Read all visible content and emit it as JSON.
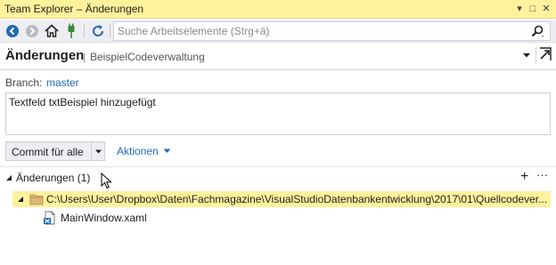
{
  "window": {
    "title": "Team Explorer – Änderungen",
    "controls": {
      "menu": "▾",
      "maximize": "□",
      "close": "✕"
    }
  },
  "toolbar": {
    "icons": [
      "back-icon",
      "forward-icon",
      "home-icon",
      "connect-icon",
      "refresh-icon"
    ],
    "search_placeholder": "Suche Arbeitselemente (Strg+ä)"
  },
  "header": {
    "title": "Änderungen",
    "separator": "|",
    "subtitle": "BeispielCodeverwaltung"
  },
  "branch": {
    "label": "Branch:",
    "value": "master"
  },
  "commit_message": "Textfeld txtBeispiel hinzugefügt",
  "commit_button": {
    "label": "Commit für alle"
  },
  "actions_label": "Aktionen",
  "changes_section": {
    "title": "Änderungen (1)",
    "add": "+",
    "more": "···",
    "folder_path": "C:\\Users\\User\\Dropbox\\Daten\\Fachmagazine\\VisualStudioDatenbankentwicklung\\2017\\01\\Quellcodever...",
    "files": [
      {
        "name": "MainWindow.xaml"
      }
    ]
  },
  "colors": {
    "titlebar": "#fff29d",
    "selected_row": "#fff29d",
    "link": "#1e6bb8",
    "toolbar": "#eeeef2"
  }
}
